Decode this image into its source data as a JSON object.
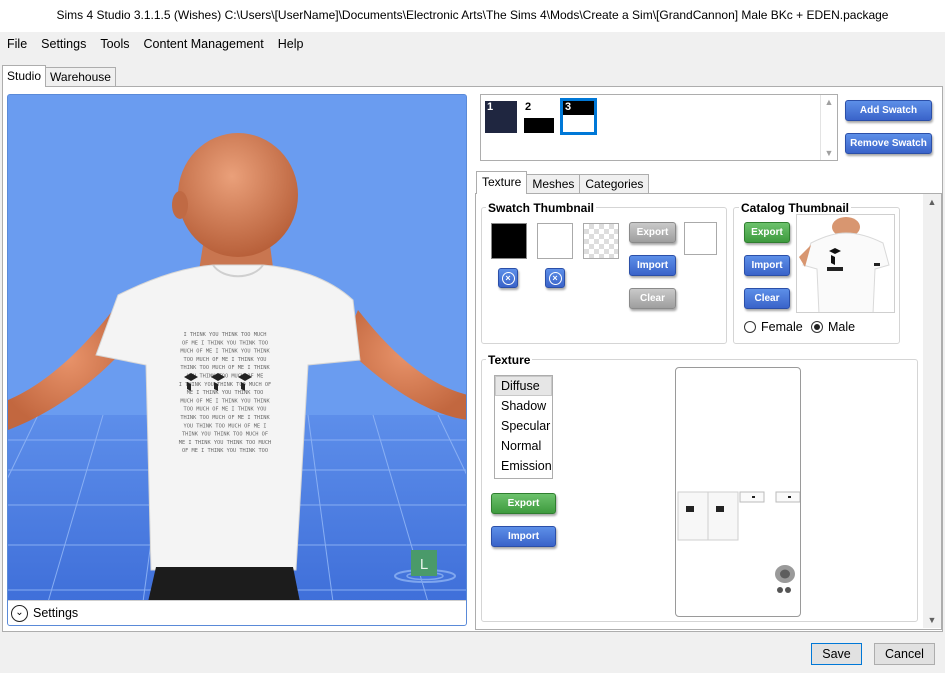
{
  "window": {
    "title": "Sims 4 Studio 3.1.1.5 (Wishes)  C:\\Users\\[UserName]\\Documents\\Electronic Arts\\The Sims 4\\Mods\\Create a Sim\\[GrandCannon] Male BKc + EDEN.package"
  },
  "menu": [
    "File",
    "Settings",
    "Tools",
    "Content Management",
    "Help"
  ],
  "main_tabs": [
    "Studio",
    "Warehouse"
  ],
  "viewport": {
    "shirt_text": [
      "I THINK YOU THINK TOO MUCH",
      "OF ME I THINK YOU THINK TOO",
      "MUCH OF ME I THINK YOU THINK",
      "TOO MUCH OF ME I THINK YOU",
      "THINK TOO MUCH OF ME I THINK",
      "YOU THINK TOO MUCH OF ME",
      "I THINK YOU THINK TOO MUCH OF",
      "ME I THINK YOU THINK TOO",
      "MUCH OF ME I THINK YOU THINK",
      "TOO MUCH OF ME I THINK YOU",
      "THINK TOO MUCH OF ME I THINK",
      "YOU THINK TOO MUCH OF ME I",
      "THINK YOU THINK TOO MUCH OF",
      "ME I THINK YOU THINK TOO MUCH",
      "OF ME I THINK YOU THINK TOO"
    ],
    "corner_badge": "L",
    "settings_label": "Settings"
  },
  "swatches": [
    {
      "number": "1",
      "color": "#1f2640"
    },
    {
      "number": "2",
      "color": "#000000"
    },
    {
      "number": "3",
      "color": "#000000"
    }
  ],
  "swatch_buttons": {
    "add": "Add Swatch",
    "remove": "Remove Swatch"
  },
  "inner_tabs": [
    "Texture",
    "Meshes",
    "Categories"
  ],
  "swatch_thumbnail": {
    "title": "Swatch Thumbnail",
    "export": "Export",
    "import": "Import",
    "clear": "Clear"
  },
  "catalog_thumbnail": {
    "title": "Catalog Thumbnail",
    "export": "Export",
    "import": "Import",
    "clear": "Clear",
    "gender_options": [
      "Female",
      "Male"
    ],
    "selected_gender": "Male"
  },
  "texture": {
    "title": "Texture",
    "channels": [
      "Diffuse",
      "Shadow",
      "Specular",
      "Normal",
      "Emission"
    ],
    "selected_channel": "Diffuse",
    "export": "Export",
    "import": "Import"
  },
  "footer": {
    "save": "Save",
    "cancel": "Cancel"
  },
  "colors": {
    "viewport_bg": "#6a9cf0",
    "accent_blue": "#3a63c9",
    "accent_green": "#3e9a3e",
    "selection": "#0078d7"
  }
}
